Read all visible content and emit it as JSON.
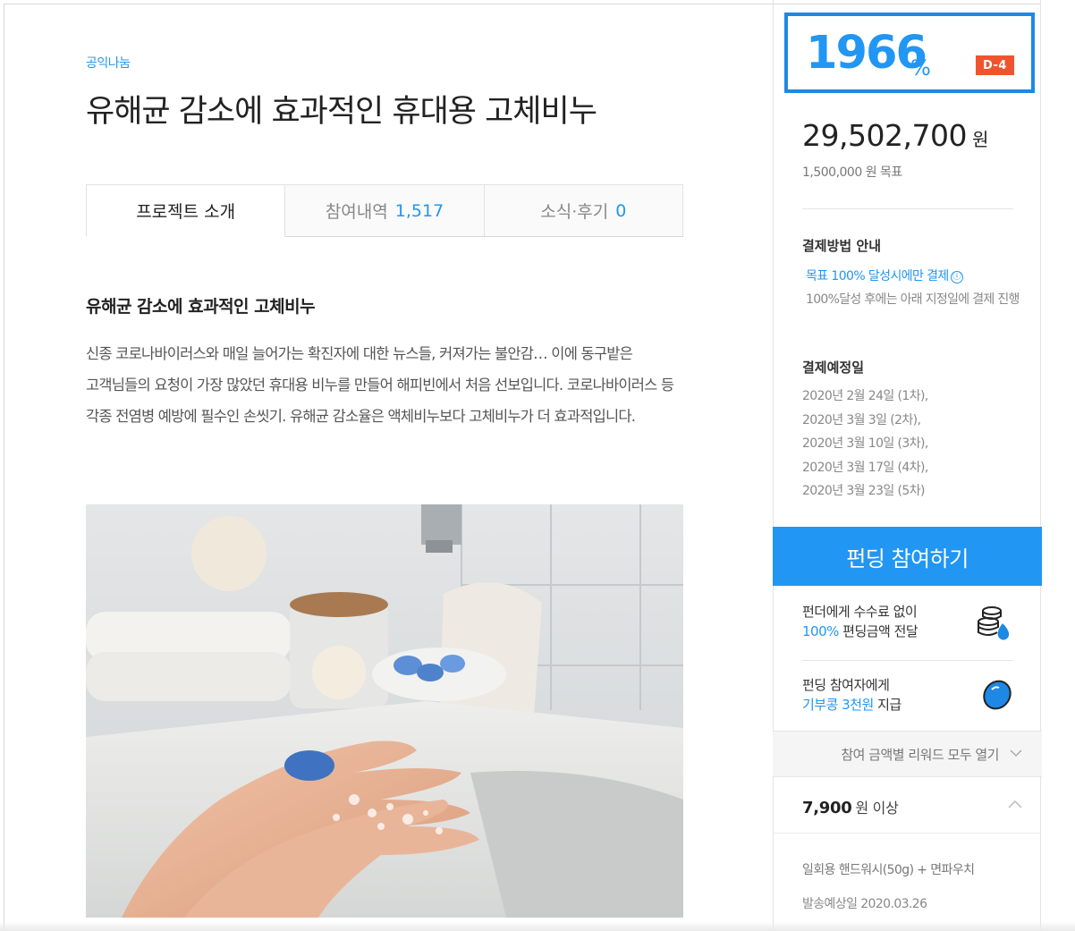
{
  "project": {
    "category": "공익나눔",
    "title": "유해균 감소에 효과적인 휴대용 고체비누"
  },
  "tabs": [
    {
      "label": "프로젝트 소개",
      "count": ""
    },
    {
      "label": "참여내역",
      "count": "1,517"
    },
    {
      "label": "소식·후기",
      "count": "0"
    }
  ],
  "content": {
    "heading": "유해균 감소에 효과적인 고체비누",
    "body": "신종 코로나바이러스와 매일 늘어가는 확진자에 대한 뉴스들, 커져가는 불안감… 이에 동구밭은 고객님들의 요청이 가장 많았던 휴대용 비누를 만들어 해피빈에서 처음 선보입니다. 코로나바이러스 등 각종 전염병 예방에 필수인 손씻기. 유해균 감소율은 액체비누보다 고체비누가 더 효과적입니다."
  },
  "funding": {
    "percent": "1966",
    "percent_unit": "%",
    "dday": "D-4",
    "amount": "29,502,700",
    "amount_unit": "원",
    "goal": "1,500,000 원 목표"
  },
  "payment": {
    "heading": "결제방법 안내",
    "condition": "목표 100% 달성시에만 결제",
    "info_icon": "ⓘ",
    "description": "100%달성 후에는 아래 지정일에 결제 진행",
    "schedule_heading": "결제예정일",
    "schedule": [
      "2020년 2월 24일 (1차),",
      "2020년 3월 3일 (2차),",
      "2020년 3월 10일 (3차),",
      "2020년 3월 17일 (4차),",
      "2020년 3월 23일 (5차)"
    ]
  },
  "cta": {
    "label": "펀딩 참여하기"
  },
  "benefits": [
    {
      "line1": "펀더에게 수수료 없이",
      "line2_highlight": "100%",
      "line2_rest": " 편딩금액 전달",
      "icon": "coin-stack-icon"
    },
    {
      "line1": "펀딩 참여자에게",
      "line2_highlight": "기부콩 3천원",
      "line2_rest": " 지급",
      "icon": "bean-icon"
    }
  ],
  "rewards": {
    "toggle_label": "참여 금액별 리워드 모두 열기",
    "item": {
      "price": "7,900",
      "price_unit": "원 이상",
      "description": "일회용 핸드워시(50g) + 면파우치",
      "shipping": "발송예상일 2020.03.26"
    }
  },
  "colors": {
    "accent": "#2196f3",
    "highlight_border": "#1e88e5",
    "dday_badge": "#f0542e"
  }
}
